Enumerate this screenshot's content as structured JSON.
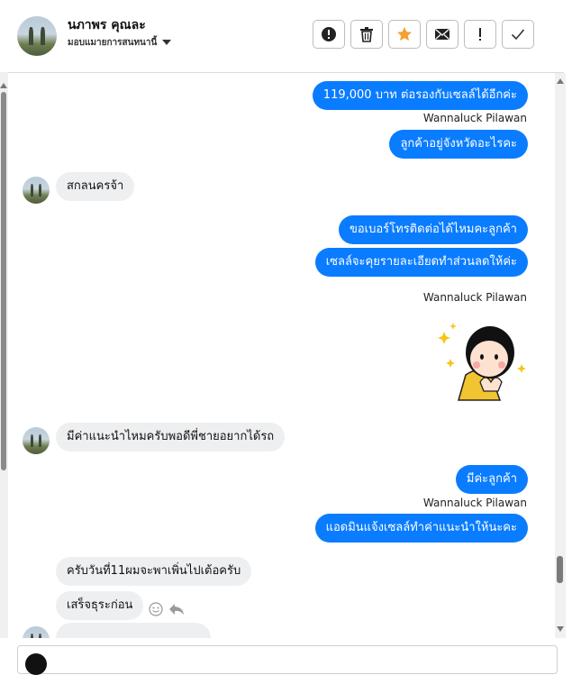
{
  "header": {
    "name": "นภาพร คุณละ",
    "subtitle": "มอบแมายการสนทนานี้",
    "actions": [
      "report",
      "delete",
      "star",
      "mark-unread",
      "spam",
      "done"
    ]
  },
  "messages": [
    {
      "dir": "out",
      "text": "119,000  บาท ต่อรองกับเซลล์ได้อีกค่ะ"
    },
    {
      "sender": "Wannaluck Pilawan"
    },
    {
      "dir": "out",
      "text": "ลูกค้าอยู่จังหวัดอะไรคะ"
    },
    {
      "dir": "in",
      "text": "สกลนครจ้า"
    },
    {
      "dir": "out",
      "text": "ขอเบอร์โทรติดต่อได้ไหมคะลูกค้า"
    },
    {
      "dir": "out",
      "text": "เซลล์จะคุยรายละเอียดทำส่วนลดให้ค่ะ"
    },
    {
      "sender": "Wannaluck Pilawan"
    },
    {
      "dir": "in",
      "text": "มีค่าแนะนำไหมครับพอดีพี่ชายอยากได้รถ"
    },
    {
      "dir": "out",
      "text": "มีค่ะลูกค้า"
    },
    {
      "sender": "Wannaluck Pilawan"
    },
    {
      "dir": "out",
      "text": "แอดมินแจ้งเซลล์ทำค่าแนะนำให้นะคะ"
    },
    {
      "dir": "in",
      "text": "ครับวันที่11ผมจะพาเพิ่นไปเต้อครับ"
    },
    {
      "dir": "in",
      "text": "เสร็จธุระก่อน"
    }
  ],
  "composer": {
    "text": ""
  }
}
